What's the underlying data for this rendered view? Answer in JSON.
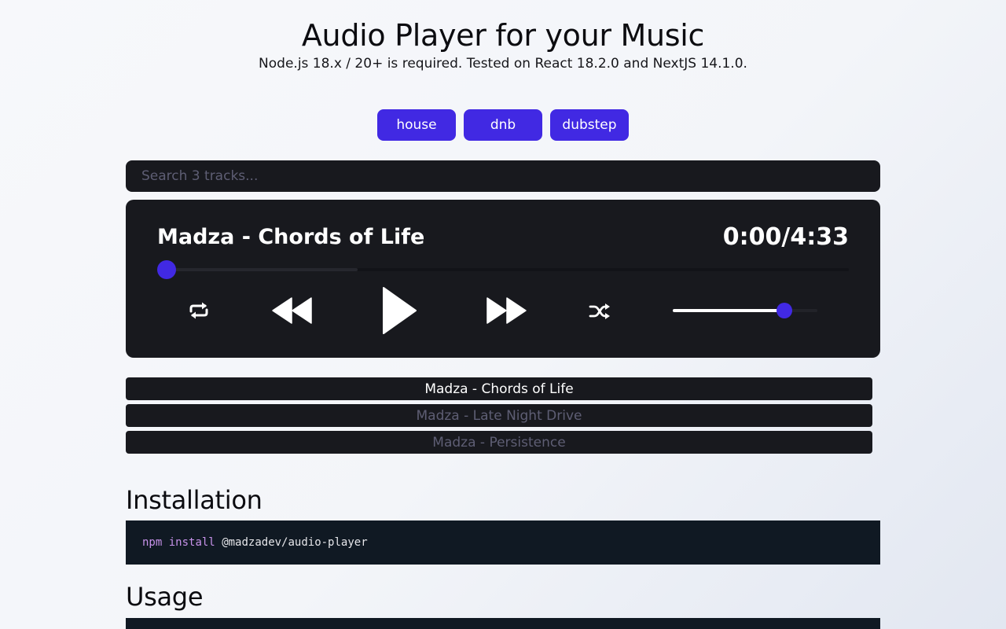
{
  "header": {
    "title": "Audio Player for your Music",
    "subtitle": "Node.js 18.x / 20+ is required. Tested on React 18.2.0 and NextJS 14.1.0."
  },
  "genres": [
    "house",
    "dnb",
    "dubstep"
  ],
  "search": {
    "placeholder": "Search 3 tracks..."
  },
  "player": {
    "track_title": "Madza - Chords of Life",
    "time": "0:00/4:33",
    "progress_fraction": 0.0,
    "buffered_fraction": 0.29,
    "volume_fraction": 0.77,
    "icons": [
      "repeat-icon",
      "rewind-icon",
      "play-icon",
      "fast-forward-icon",
      "shuffle-icon"
    ]
  },
  "playlist": [
    {
      "title": "Madza - Chords of Life",
      "active": true
    },
    {
      "title": "Madza - Late Night Drive",
      "active": false
    },
    {
      "title": "Madza - Persistence",
      "active": false
    }
  ],
  "installation": {
    "heading": "Installation",
    "code_cmd": "npm",
    "code_sub": "install",
    "code_pkg": "@madzadev/audio-player"
  },
  "usage": {
    "heading": "Usage"
  },
  "colors": {
    "accent": "#4129e3",
    "panel": "#18191e",
    "code_bg": "#101923",
    "muted_text": "#5e5e74"
  }
}
